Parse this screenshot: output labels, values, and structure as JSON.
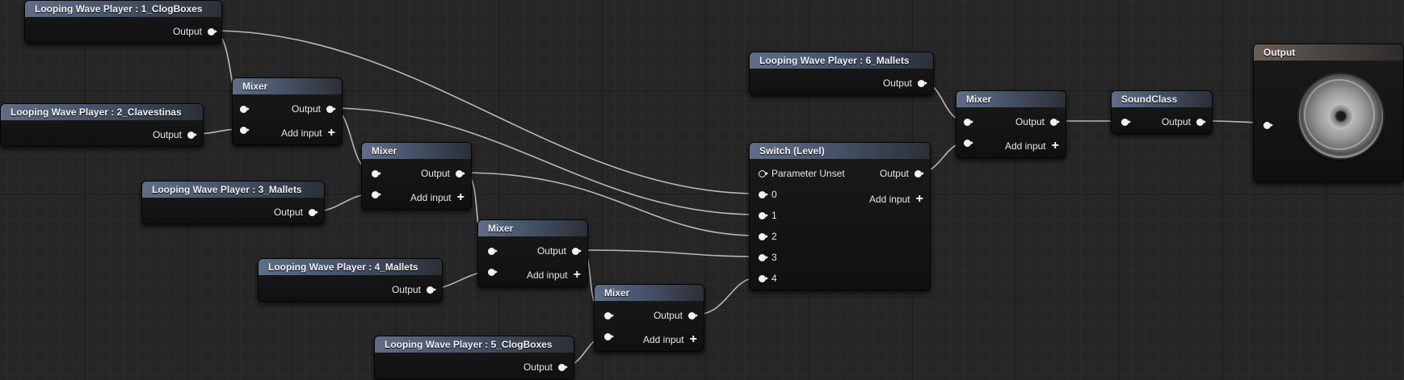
{
  "graph": {
    "wave_players": [
      {
        "title": "Looping Wave Player : 1_ClogBoxes",
        "output_label": "Output"
      },
      {
        "title": "Looping Wave Player : 2_Clavestinas",
        "output_label": "Output"
      },
      {
        "title": "Looping Wave Player : 3_Mallets",
        "output_label": "Output"
      },
      {
        "title": "Looping Wave Player : 4_Mallets",
        "output_label": "Output"
      },
      {
        "title": "Looping Wave Player : 5_ClogBoxes",
        "output_label": "Output"
      },
      {
        "title": "Looping Wave Player : 6_Mallets",
        "output_label": "Output"
      }
    ],
    "mixers": [
      {
        "title": "Mixer",
        "output_label": "Output",
        "add_input_label": "Add input"
      },
      {
        "title": "Mixer",
        "output_label": "Output",
        "add_input_label": "Add input"
      },
      {
        "title": "Mixer",
        "output_label": "Output",
        "add_input_label": "Add input"
      },
      {
        "title": "Mixer",
        "output_label": "Output",
        "add_input_label": "Add input"
      },
      {
        "title": "Mixer",
        "output_label": "Output",
        "add_input_label": "Add input"
      }
    ],
    "switch": {
      "title": "Switch (Level)",
      "parameter_unset_label": "Parameter Unset",
      "output_label": "Output",
      "add_input_label": "Add input",
      "inputs": [
        "0",
        "1",
        "2",
        "3",
        "4"
      ]
    },
    "sound_class": {
      "title": "SoundClass",
      "output_label": "Output"
    },
    "output": {
      "title": "Output"
    },
    "colors": {
      "wire": "#c9c9c9",
      "header": "#5f6e87",
      "output_header": "#6b5f56",
      "grid": "#262626"
    }
  }
}
